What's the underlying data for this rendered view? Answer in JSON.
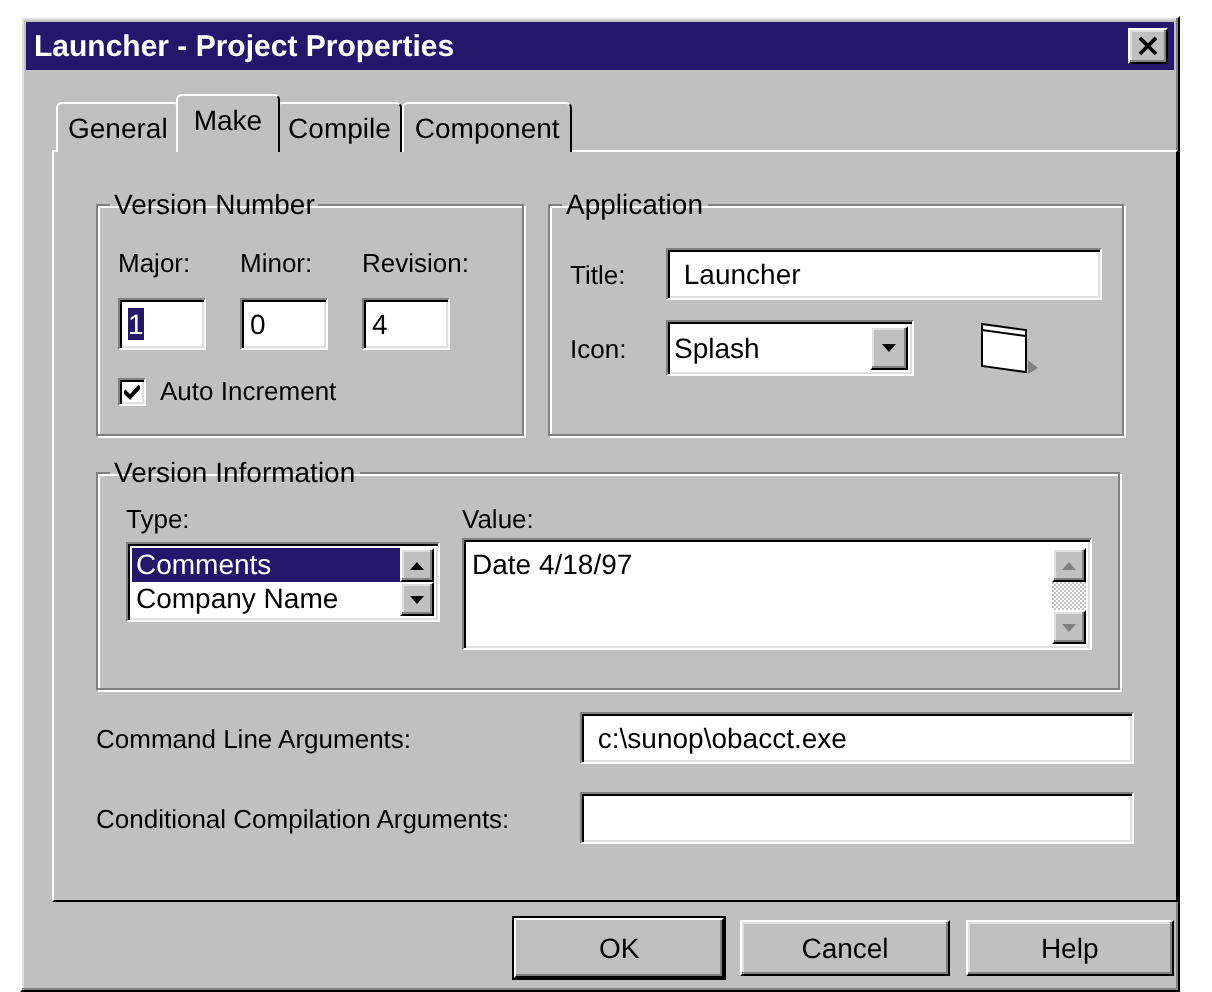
{
  "window": {
    "title": "Launcher - Project Properties",
    "close": "×"
  },
  "tabs": [
    {
      "label": "General",
      "selected": false
    },
    {
      "label": "Make",
      "selected": true
    },
    {
      "label": "Compile",
      "selected": false
    },
    {
      "label": "Component",
      "selected": false
    }
  ],
  "version_number": {
    "legend": "Version Number",
    "fields": [
      {
        "label": "Major:",
        "value": "1",
        "focused": true
      },
      {
        "label": "Minor:",
        "value": "0",
        "focused": false
      },
      {
        "label": "Revision:",
        "value": "4",
        "focused": false
      }
    ],
    "auto_increment": {
      "label": "Auto Increment",
      "checked": true
    }
  },
  "application": {
    "legend": "Application",
    "title": {
      "label": "Title:",
      "value": "Launcher"
    },
    "icon": {
      "label": "Icon:",
      "value": "Splash"
    }
  },
  "version_information": {
    "legend": "Version Information",
    "type": {
      "label": "Type:",
      "items": [
        {
          "label": "Comments",
          "selected": true
        },
        {
          "label": "Company Name",
          "selected": false
        }
      ]
    },
    "value": {
      "label": "Value:",
      "text": "Date 4/18/97"
    }
  },
  "command_line": {
    "label": "Command Line Arguments:",
    "value": "c:\\sunop\\obacct.exe"
  },
  "conditional": {
    "label": "Conditional Compilation Arguments:"
  },
  "buttons": [
    {
      "label": "OK",
      "default": true
    },
    {
      "label": "Cancel",
      "default": false
    },
    {
      "label": "Help",
      "default": false
    }
  ]
}
